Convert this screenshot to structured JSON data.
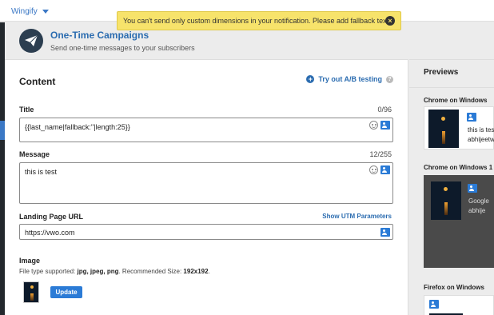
{
  "topbar": {
    "brand": "Wingify"
  },
  "toast": {
    "message": "You can't send only custom dimensions in your notification. Please add fallback text."
  },
  "header": {
    "title": "One-Time Campaigns",
    "subtitle": "Send one-time messages to your subscribers"
  },
  "content": {
    "section_title": "Content",
    "ab_link": "Try out A/B testing",
    "title_field": {
      "label": "Title",
      "count": "0/96",
      "value": "{{last_name|fallback:''|length:25}}"
    },
    "message_field": {
      "label": "Message",
      "count": "12/255",
      "value": "this is test"
    },
    "url_field": {
      "label": "Landing Page URL",
      "utm_link": "Show UTM Parameters",
      "value": "https://vwo.com"
    },
    "image": {
      "label": "Image",
      "hint_prefix": "File type supported: ",
      "hint_types": "jpg, jpeg, png",
      "hint_mid": ". Recommended Size: ",
      "hint_size": "192x192",
      "hint_end": ".",
      "update_label": "Update"
    }
  },
  "previews": {
    "title": "Previews",
    "items": [
      {
        "label": "Chrome on Windows",
        "text1": "this is tes",
        "text2": "abhijeetw"
      },
      {
        "label": "Chrome on Windows 1",
        "text1": "Google",
        "text2": "abhije"
      },
      {
        "label": "Firefox on Windows"
      }
    ]
  },
  "colors": {
    "accent": "#2b7bd6",
    "toast_bg": "#f7e36b",
    "sidebar": "#23282d"
  }
}
